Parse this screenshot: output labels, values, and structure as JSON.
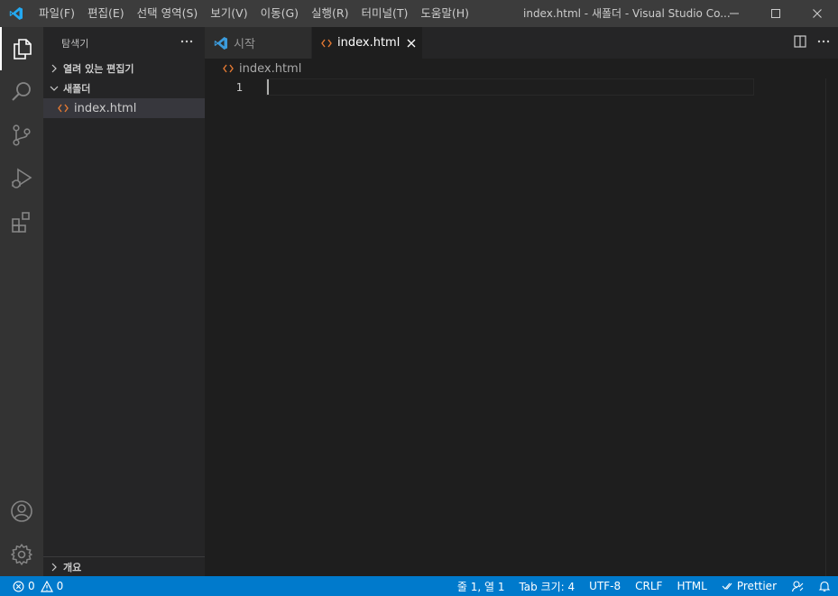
{
  "titlebar": {
    "menu": [
      "파일(F)",
      "편집(E)",
      "선택 영역(S)",
      "보기(V)",
      "이동(G)",
      "실행(R)",
      "터미널(T)",
      "도움말(H)"
    ],
    "window_title": "index.html - 새폴더 - Visual Studio Co..."
  },
  "sidebar": {
    "title": "탐색기",
    "open_editors": "열려 있는 편집기",
    "folder": "새폴더",
    "files": [
      {
        "name": "index.html",
        "icon": "html-file-icon"
      }
    ],
    "outline": "개요"
  },
  "editor": {
    "tabs": [
      {
        "label": "시작",
        "icon": "vscode-logo-icon",
        "active": false
      },
      {
        "label": "index.html",
        "icon": "html-file-icon",
        "active": true
      }
    ],
    "breadcrumb": "index.html",
    "line_numbers": [
      "1"
    ]
  },
  "statusbar": {
    "errors": "0",
    "warnings": "0",
    "position": "줄 1, 열 1",
    "tab_size": "Tab 크기: 4",
    "encoding": "UTF-8",
    "eol": "CRLF",
    "language": "HTML",
    "prettier": "Prettier"
  },
  "colors": {
    "accent": "#007acc",
    "titlebar": "#3c3c3c",
    "activitybar": "#333333",
    "sidebar": "#252526",
    "editor": "#1e1e1e",
    "html_icon": "#e37933"
  }
}
